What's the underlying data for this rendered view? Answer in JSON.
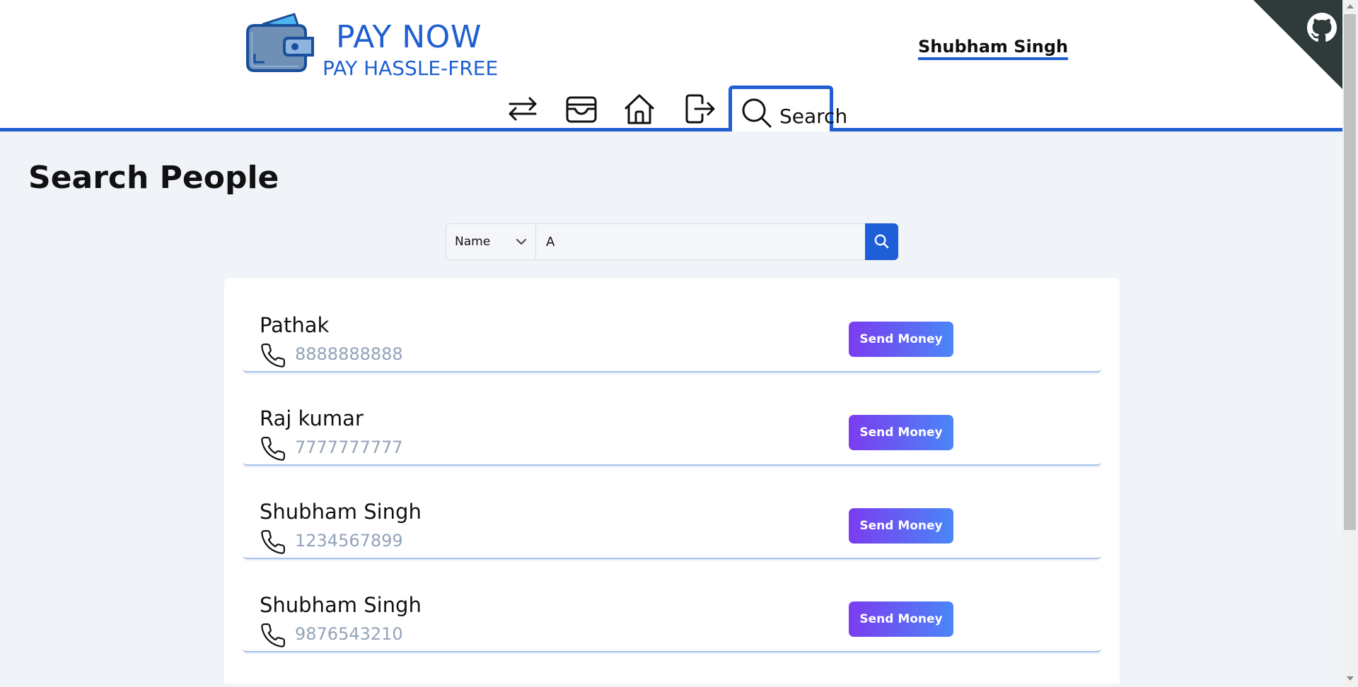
{
  "brand": {
    "title": "PAY NOW",
    "tagline": "PAY HASSLE-FREE",
    "logo_icon": "wallet-icon"
  },
  "header": {
    "username": "Shubham Singh",
    "github_icon": "github-icon"
  },
  "nav": {
    "items": [
      {
        "icon": "transfer-arrows-icon"
      },
      {
        "icon": "wallet-outline-icon"
      },
      {
        "icon": "home-icon"
      },
      {
        "icon": "logout-icon"
      }
    ],
    "active_tab": {
      "label": "Search",
      "icon": "search-icon"
    }
  },
  "page": {
    "title": "Search People"
  },
  "search": {
    "filter_selected": "Name",
    "query": "A"
  },
  "results": [
    {
      "name": "Pathak",
      "phone": "8888888888",
      "action": "Send Money"
    },
    {
      "name": "Raj kumar",
      "phone": "7777777777",
      "action": "Send Money"
    },
    {
      "name": "Shubham Singh",
      "phone": "1234567899",
      "action": "Send Money"
    },
    {
      "name": "Shubham Singh",
      "phone": "9876543210",
      "action": "Send Money"
    }
  ],
  "colors": {
    "primary": "#1f5fd1",
    "background": "#f0f3f8",
    "button_gradient_start": "#7b3cf0",
    "button_gradient_end": "#4a86f7",
    "phone_text": "#94a3b8"
  }
}
